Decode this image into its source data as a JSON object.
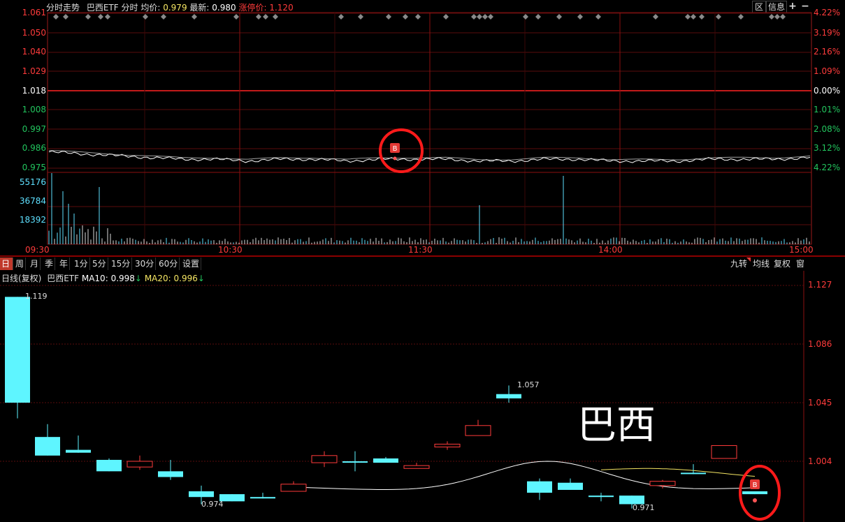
{
  "intraday": {
    "panel_title": "分时走势",
    "name": "巴西ETF",
    "mode": "分时",
    "avg_label": "均价:",
    "avg_value": "0.979",
    "last_label": "最新:",
    "last_value": "0.980",
    "limit_label": "涨停价:",
    "limit_value": "1.120",
    "buttons": {
      "zone": "区",
      "info": "信息",
      "plus": "+",
      "minus": "−"
    },
    "price_ticks": [
      "1.061",
      "1.050",
      "1.040",
      "1.029",
      "1.018",
      "1.008",
      "0.997",
      "0.986",
      "0.975"
    ],
    "pct_ticks": [
      "4.22%",
      "3.19%",
      "2.16%",
      "1.09%",
      "0.00%",
      "1.01%",
      "2.08%",
      "3.12%",
      "4.22%"
    ],
    "vol_ticks": [
      "55176",
      "36784",
      "18392"
    ],
    "time_ticks": [
      "09:30",
      "10:30",
      "11:30",
      "14:00",
      "15:00"
    ],
    "buy_marker": "B",
    "colors": {
      "up": "#ff3b3b",
      "down": "#22c55e",
      "grid": "#7a1010",
      "base": "#ffffff"
    }
  },
  "daily": {
    "tabs": [
      "日",
      "周",
      "月",
      "季",
      "年",
      "1分",
      "5分",
      "15分",
      "30分",
      "60分",
      "设置"
    ],
    "active_tab": "日",
    "right_buttons": [
      "九转",
      "均线",
      "复权",
      "窗"
    ],
    "indicator": {
      "title": "日线(复权)",
      "name": "巴西ETF",
      "ma10_label": "MA10:",
      "ma10_value": "0.998",
      "ma20_label": "MA20:",
      "ma20_value": "0.996",
      "arrow": "↓"
    },
    "price_ticks": [
      "1.127",
      "1.086",
      "1.045",
      "1.004"
    ],
    "annotations": {
      "high": "1.119",
      "peak": "1.057",
      "low1": "0.974",
      "low2": "0.971"
    },
    "overlay_text": "巴西",
    "buy_marker": "B"
  },
  "chart_data": [
    {
      "type": "line",
      "title": "分时走势",
      "series": [
        {
          "name": "巴西ETF",
          "values": [
            0.984,
            0.983,
            0.982,
            0.981,
            0.98,
            0.98,
            0.979,
            0.98,
            0.98,
            0.979,
            0.98,
            0.98,
            0.98,
            0.979,
            0.979,
            0.98,
            0.98,
            0.979,
            0.979,
            0.979,
            0.98,
            0.98,
            0.98,
            0.981
          ]
        }
      ],
      "x": [
        "09:30",
        "10:30",
        "11:30",
        "14:00",
        "15:00"
      ],
      "ylim": [
        0.975,
        1.061
      ]
    },
    {
      "type": "bar",
      "title": "日线(复权)",
      "candles": [
        {
          "o": 1.119,
          "c": 1.045,
          "h": 1.119,
          "l": 1.034,
          "up": false
        },
        {
          "o": 1.021,
          "c": 1.008,
          "h": 1.03,
          "l": 1.008,
          "up": false
        },
        {
          "o": 1.01,
          "c": 1.012,
          "h": 1.022,
          "l": 1.01,
          "up": false
        },
        {
          "o": 1.005,
          "c": 0.997,
          "h": 1.006,
          "l": 0.997,
          "up": false
        },
        {
          "o": 1.0,
          "c": 1.004,
          "h": 1.008,
          "l": 0.998,
          "up": true
        },
        {
          "o": 0.997,
          "c": 0.993,
          "h": 1.005,
          "l": 0.991,
          "up": false
        },
        {
          "o": 0.983,
          "c": 0.979,
          "h": 0.987,
          "l": 0.974,
          "up": false
        },
        {
          "o": 0.981,
          "c": 0.976,
          "h": 0.981,
          "l": 0.976,
          "up": false
        },
        {
          "o": 0.979,
          "c": 0.978,
          "h": 0.982,
          "l": 0.978,
          "up": false
        },
        {
          "o": 0.983,
          "c": 0.988,
          "h": 0.99,
          "l": 0.983,
          "up": true
        },
        {
          "o": 1.003,
          "c": 1.008,
          "h": 1.011,
          "l": 1.0,
          "up": true
        },
        {
          "o": 1.004,
          "c": 1.004,
          "h": 1.011,
          "l": 0.997,
          "up": false
        },
        {
          "o": 1.006,
          "c": 1.003,
          "h": 1.007,
          "l": 1.003,
          "up": false
        },
        {
          "o": 0.999,
          "c": 1.001,
          "h": 1.003,
          "l": 0.999,
          "up": true
        },
        {
          "o": 1.014,
          "c": 1.016,
          "h": 1.018,
          "l": 1.012,
          "up": true
        },
        {
          "o": 1.022,
          "c": 1.029,
          "h": 1.033,
          "l": 1.022,
          "up": true
        },
        {
          "o": 1.051,
          "c": 1.048,
          "h": 1.057,
          "l": 1.045,
          "up": false
        },
        {
          "o": 0.99,
          "c": 0.982,
          "h": 0.992,
          "l": 0.977,
          "up": false
        },
        {
          "o": 0.989,
          "c": 0.984,
          "h": 0.992,
          "l": 0.984,
          "up": false
        },
        {
          "o": 0.98,
          "c": 0.979,
          "h": 0.982,
          "l": 0.976,
          "up": false
        },
        {
          "o": 0.98,
          "c": 0.974,
          "h": 0.98,
          "l": 0.971,
          "up": false
        },
        {
          "o": 0.987,
          "c": 0.99,
          "h": 0.991,
          "l": 0.985,
          "up": true
        },
        {
          "o": 0.996,
          "c": 0.996,
          "h": 1.002,
          "l": 0.995,
          "up": false
        },
        {
          "o": 1.006,
          "c": 1.015,
          "h": 1.015,
          "l": 1.006,
          "up": true
        },
        {
          "o": 0.983,
          "c": 0.981,
          "h": 0.983,
          "l": 0.981,
          "up": false
        }
      ],
      "ylim": [
        0.96,
        1.127
      ]
    }
  ]
}
